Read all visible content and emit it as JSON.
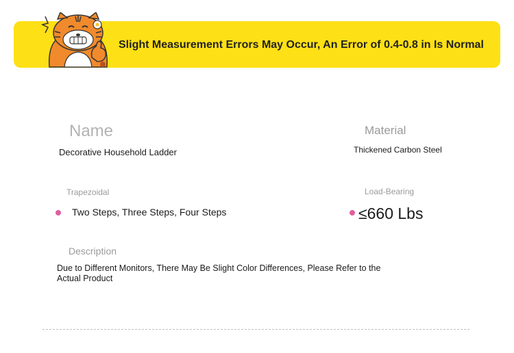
{
  "banner": {
    "text": "Slight Measurement Errors May Occur, An Error of 0.4-0.8 in Is Normal",
    "color": "#fde015"
  },
  "specs": {
    "name": {
      "label": "Name",
      "value": "Decorative Household Ladder"
    },
    "material": {
      "label": "Material",
      "value": "Thickened Carbon Steel"
    },
    "trapezoidal": {
      "label": "Trapezoidal",
      "value": "Two Steps, Three Steps, Four Steps"
    },
    "load_bearing": {
      "label": "Load-Bearing",
      "value": "≤660 Lbs"
    },
    "description": {
      "label": "Description",
      "value": "Due to Different Monitors, There May Be Slight Color Differences, Please Refer to the Actual Product"
    }
  },
  "icons": {
    "mascot": "tiger-mascot-thumbs-up-icon",
    "bullet": "pink-dot-icon"
  },
  "accent_color": "#e05ea0"
}
